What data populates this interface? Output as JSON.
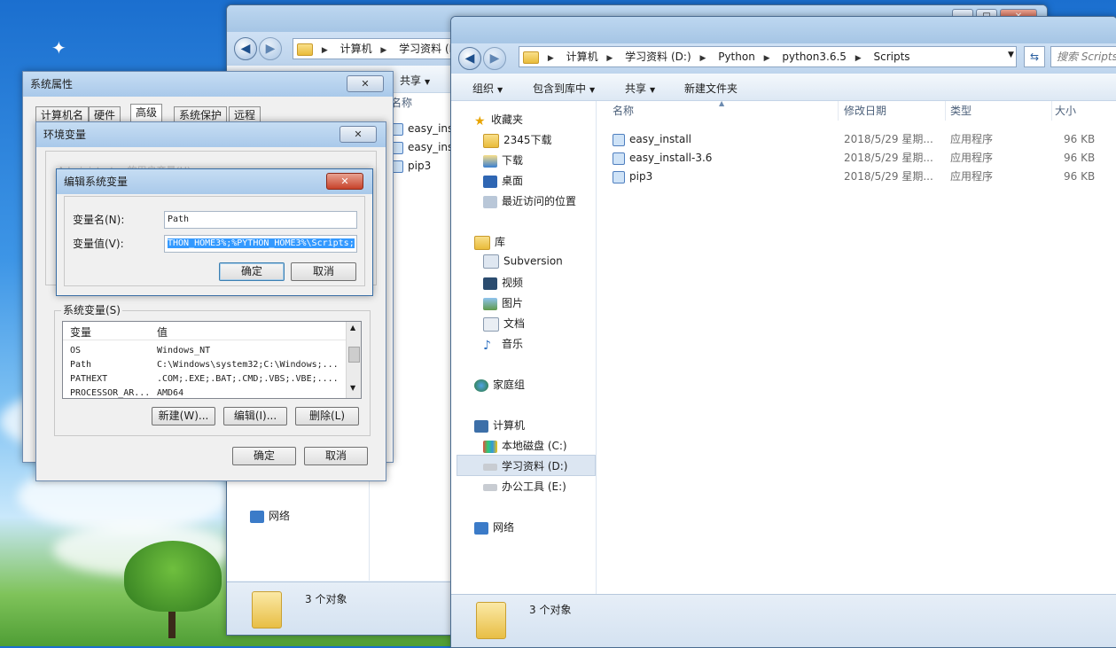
{
  "colors": {
    "accent": "#3399ff",
    "close_red": "#c7422a"
  },
  "back_window": {
    "address": [
      "计算机",
      "学习资料 (D:)"
    ],
    "toolbar": {
      "share": "共享"
    },
    "col_name": "名称",
    "files": [
      "easy_inst",
      "easy_inst",
      "pip3"
    ],
    "nav_network": "网络",
    "status": "3 个对象"
  },
  "front_window": {
    "address": [
      "计算机",
      "学习资料 (D:)",
      "Python",
      "python3.6.5",
      "Scripts"
    ],
    "search_placeholder": "搜索 Scripts",
    "toolbar": {
      "organize": "组织",
      "include": "包含到库中",
      "share": "共享",
      "new_folder": "新建文件夹"
    },
    "nav": {
      "favorites": "收藏夹",
      "fav_items": [
        "2345下载",
        "下载",
        "桌面",
        "最近访问的位置"
      ],
      "libraries": "库",
      "lib_items": [
        "Subversion",
        "视频",
        "图片",
        "文档",
        "音乐"
      ],
      "homegroup": "家庭组",
      "computer": "计算机",
      "drives": [
        "本地磁盘 (C:)",
        "学习资料 (D:)",
        "办公工具 (E:)"
      ],
      "network": "网络"
    },
    "columns": {
      "name": "名称",
      "date": "修改日期",
      "type": "类型",
      "size": "大小"
    },
    "files": [
      {
        "name": "easy_install",
        "date": "2018/5/29 星期...",
        "type": "应用程序",
        "size": "96 KB"
      },
      {
        "name": "easy_install-3.6",
        "date": "2018/5/29 星期...",
        "type": "应用程序",
        "size": "96 KB"
      },
      {
        "name": "pip3",
        "date": "2018/5/29 星期...",
        "type": "应用程序",
        "size": "96 KB"
      }
    ],
    "status": "3 个对象"
  },
  "sys_props": {
    "title": "系统属性",
    "tabs": [
      "计算机名",
      "硬件",
      "高级",
      "系统保护",
      "远程"
    ]
  },
  "env_vars": {
    "title": "环境变量",
    "user_vars_label_partial": "Administrator 的用户变量(U)",
    "system_vars_label": "系统变量(S)",
    "col_var": "变量",
    "col_val": "值",
    "rows": [
      {
        "var": "OS",
        "val": "Windows_NT"
      },
      {
        "var": "Path",
        "val": "C:\\Windows\\system32;C:\\Windows;..."
      },
      {
        "var": "PATHEXT",
        "val": ".COM;.EXE;.BAT;.CMD;.VBS;.VBE;...."
      },
      {
        "var": "PROCESSOR_AR...",
        "val": "AMD64"
      }
    ],
    "new_btn": "新建(W)...",
    "edit_btn": "编辑(I)...",
    "delete_btn": "删除(L)",
    "ok": "确定",
    "cancel": "取消"
  },
  "edit_var": {
    "title": "编辑系统变量",
    "name_label": "变量名(N):",
    "name_value": "Path",
    "value_label": "变量值(V):",
    "value_value": "THON_HOME3%;%PYTHON_HOME3%\\Scripts;",
    "ok": "确定",
    "cancel": "取消",
    "close": "✕"
  }
}
